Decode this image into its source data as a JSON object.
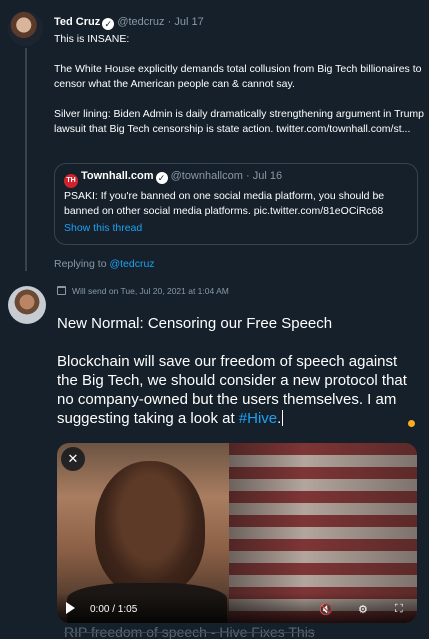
{
  "quoted_tweet": {
    "author_name": "Ted Cruz",
    "author_handle": "@tedcruz",
    "date": "Jul 17",
    "text_paragraphs": [
      "This is INSANE:",
      "The White House explicitly demands total collusion from Big Tech billionaires to censor what the American people can & cannot say.",
      "Silver lining: Biden Admin is daily dramatically strengthening argument in Trump lawsuit that Big Tech censorship is state action. twitter.com/townhall.com/st..."
    ],
    "embedded": {
      "logo_text": "TH",
      "author_name": "Townhall.com",
      "author_handle": "@townhallcom",
      "date": "Jul 16",
      "text": "PSAKI: If you're banned on one social media platform, you should be banned on other social media platforms. pic.twitter.com/81eOCiRc68",
      "show_thread": "Show this thread"
    }
  },
  "reply": {
    "prefix": "Replying to",
    "handle": "@tedcruz"
  },
  "compose": {
    "schedule_text": "Will send on Tue, Jul 20, 2021 at 1:04 AM",
    "title": "New Normal: Censoring our Free Speech",
    "body_before": "Blockchain will save our freedom of speech against the Big Tech, we should consider a new protocol that no company-owned but the users themselves. I am suggesting taking a look at ",
    "hashtag": "#Hive",
    "body_after": "."
  },
  "video": {
    "time": "0:00 / 1:05",
    "caption": "RIP freedom of speech - Hive Fixes This"
  },
  "icons": {
    "close": "close-icon",
    "play": "play-icon",
    "mute": "mute-icon",
    "settings": "gear-icon",
    "fullscreen": "fullscreen-icon",
    "verified": "verified-badge-icon",
    "schedule": "calendar-icon"
  },
  "colors": {
    "background": "#15202b",
    "accent": "#1da1f2",
    "muted": "#8899a6",
    "warning_dot": "#ffad1f"
  }
}
